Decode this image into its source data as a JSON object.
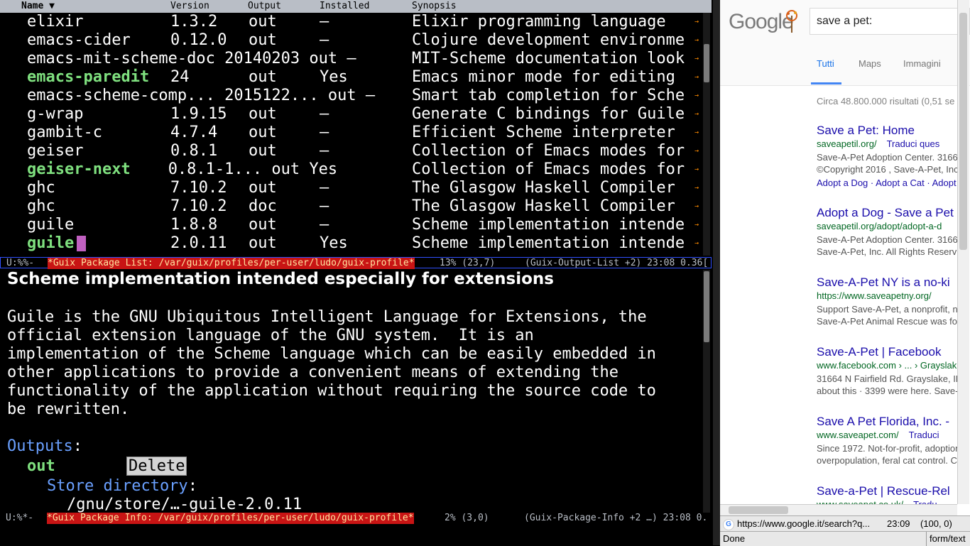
{
  "package_list": {
    "columns": {
      "name": "Name ▼",
      "version": "Version",
      "output": "Output",
      "installed": "Installed",
      "synopsis": "Synopsis"
    },
    "rows": [
      {
        "name": "elixir",
        "version": "1.3.2",
        "output": "out",
        "installed": "–",
        "synopsis": "Elixir programming language",
        "is_installed": false
      },
      {
        "name": "emacs-cider",
        "version": "0.12.0",
        "output": "out",
        "installed": "–",
        "synopsis": "Clojure development environme",
        "is_installed": false
      },
      {
        "name": "emacs-mit-scheme-doc",
        "version": "20140203",
        "output": "out",
        "installed": "–",
        "synopsis": "MIT-Scheme documentation look",
        "is_installed": false,
        "compact": true
      },
      {
        "name": "emacs-paredit",
        "version": "24",
        "output": "out",
        "installed": "Yes",
        "synopsis": "Emacs minor mode for editing",
        "is_installed": true
      },
      {
        "name": "emacs-scheme-comp...",
        "version": "2015122...",
        "output": "out",
        "installed": "–",
        "synopsis": "Smart tab completion for Sche",
        "is_installed": false,
        "compact": true
      },
      {
        "name": "g-wrap",
        "version": "1.9.15",
        "output": "out",
        "installed": "–",
        "synopsis": "Generate C bindings for Guile",
        "is_installed": false
      },
      {
        "name": "gambit-c",
        "version": "4.7.4",
        "output": "out",
        "installed": "–",
        "synopsis": "Efficient Scheme interpreter",
        "is_installed": false
      },
      {
        "name": "geiser",
        "version": "0.8.1",
        "output": "out",
        "installed": "–",
        "synopsis": "Collection of Emacs modes for",
        "is_installed": false
      },
      {
        "name": "geiser-next",
        "version": "0.8.1-1...",
        "output": "out",
        "installed": "Yes",
        "synopsis": "Collection of Emacs modes for",
        "is_installed": true,
        "compact": true
      },
      {
        "name": "ghc",
        "version": "7.10.2",
        "output": "out",
        "installed": "–",
        "synopsis": "The Glasgow Haskell Compiler",
        "is_installed": false
      },
      {
        "name": "ghc",
        "version": "7.10.2",
        "output": "doc",
        "installed": "–",
        "synopsis": "The Glasgow Haskell Compiler",
        "is_installed": false
      },
      {
        "name": "guile",
        "version": "1.8.8",
        "output": "out",
        "installed": "–",
        "synopsis": "Scheme implementation intende",
        "is_installed": false
      },
      {
        "name": "guile",
        "version": "2.0.11",
        "output": "out",
        "installed": "Yes",
        "synopsis": "Scheme implementation intende",
        "is_installed": true,
        "cursor": true
      }
    ],
    "modeline": {
      "state": "U:%%-",
      "buffer": "*Guix Package List: /var/guix/profiles/per-user/ludo/guix-profile*",
      "position": "13% (23,7)",
      "mode": "(Guix-Output-List +2) 23:08 0.36["
    }
  },
  "package_info": {
    "heading": "Scheme implementation intended especially for extensions",
    "description": [
      "Guile is the GNU Ubiquitous Intelligent Language for Extensions, the",
      "official extension language of the GNU system.  It is an",
      "implementation of the Scheme language which can be easily embedded in",
      "other applications to provide a convenient means of extending the",
      "functionality of the application without requiring the source code to",
      "be rewritten."
    ],
    "outputs_label": "Outputs",
    "output_name": "out",
    "delete_label": "Delete",
    "store_label": "Store directory",
    "store_path": "/gnu/store/…-guile-2.0.11",
    "modeline": {
      "state": "U:%*-",
      "buffer": "*Guix Package Info: /var/guix/profiles/per-user/ludo/guix-profile*",
      "position": "2% (3,0)",
      "mode": "(Guix-Package-Info +2 …) 23:08 0."
    }
  },
  "browser": {
    "logo": "Google",
    "search_value": "save a pet:",
    "tabs": [
      "Tutti",
      "Maps",
      "Immagini"
    ],
    "result_count": "Circa 48.800.000 risultati (0,51 se",
    "results": [
      {
        "title": "Save a Pet: Home",
        "url": "saveapetil.org/",
        "translate": "Traduci ques",
        "snippet1": "Save-A-Pet Adoption Center. 3166",
        "snippet2": "©Copyright 2016 , Save-A-Pet, Inc",
        "sublinks": "Adopt a Dog · Adopt a Cat · Adopt"
      },
      {
        "title": "Adopt a Dog - Save a Pet",
        "url": "saveapetil.org/adopt/adopt-a-d",
        "snippet1": "Save-A-Pet Adoption Center. 3166",
        "snippet2": "Save-A-Pet, Inc. All Rights Reserv"
      },
      {
        "title": "Save-A-Pet NY is a no-ki",
        "url": "https://www.saveapetny.org/",
        "snippet1": "Support Save-A-Pet, a nonprofit, n",
        "snippet2": "Save-A-Pet Animal Rescue was fo"
      },
      {
        "title": "Save-A-Pet | Facebook",
        "url": "www.facebook.com › ... › Grayslak",
        "snippet1": "31664 N Fairfield Rd. Grayslake, IL",
        "snippet2": "about this · 3399 were here. Save-"
      },
      {
        "title": "Save A Pet Florida, Inc. -",
        "url": "www.saveapet.com/",
        "translate": "Traduci",
        "snippet1": "Since 1972. Not-for-profit, adoption",
        "snippet2": "overpopulation, feral cat control. Ca"
      },
      {
        "title": "Save-a-Pet | Rescue-Rel",
        "url": "www.saveapet.co.uk/",
        "translate": "Tradu"
      }
    ],
    "address": "https://www.google.it/search?q...",
    "time": "23:09",
    "coords": "(100, 0)",
    "status": "Done",
    "content_type": "form/text"
  },
  "colors": {
    "installed": "#7fe07f",
    "cursor": "#c060c0",
    "modeline_buffer": "#c81414",
    "link": "#1a0dab"
  }
}
